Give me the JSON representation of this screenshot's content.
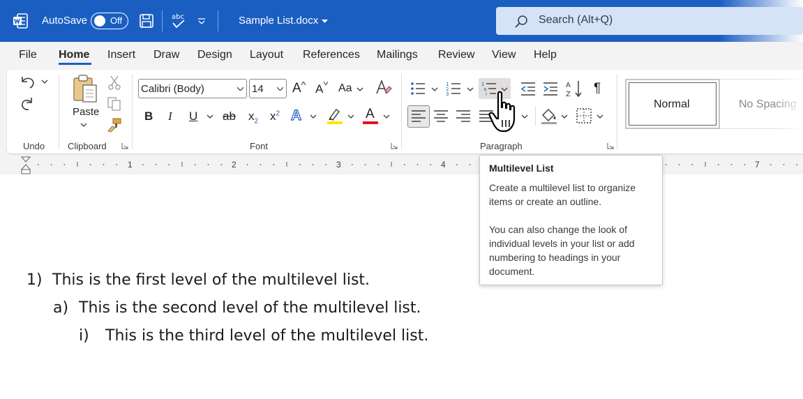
{
  "colors": {
    "accent": "#1a5ec2",
    "titlebar": "#1a5ec2",
    "search_bg": "#d4e3f6",
    "highlight_yellow": "#ffe600",
    "font_red": "#e81123"
  },
  "titlebar": {
    "autosave_label": "AutoSave",
    "autosave_state": "Off",
    "document_name": "Sample List.docx",
    "search_placeholder": "Search (Alt+Q)"
  },
  "tabs": [
    {
      "label": "File"
    },
    {
      "label": "Home",
      "active": true
    },
    {
      "label": "Insert"
    },
    {
      "label": "Draw"
    },
    {
      "label": "Design"
    },
    {
      "label": "Layout"
    },
    {
      "label": "References"
    },
    {
      "label": "Mailings"
    },
    {
      "label": "Review"
    },
    {
      "label": "View"
    },
    {
      "label": "Help"
    }
  ],
  "ribbon": {
    "undo_group": "Undo",
    "clipboard_group": "Clipboard",
    "paste_label": "Paste",
    "font_group": "Font",
    "font_name": "Calibri (Body)",
    "font_size": "14",
    "grow_font": "A",
    "shrink_font": "A",
    "change_case": "Aa",
    "bold": "B",
    "italic": "I",
    "underline": "U",
    "strikethrough": "ab",
    "subscript": "x",
    "superscript": "x",
    "subscript_mark": "2",
    "superscript_mark": "2",
    "text_effects": "A",
    "font_color": "A",
    "paragraph_group": "Paragraph",
    "styles": {
      "normal": "Normal",
      "no_spacing": "No Spacing"
    }
  },
  "ruler": {
    "numbers": [
      "1",
      "2",
      "3",
      "4",
      "7"
    ]
  },
  "tooltip": {
    "title": "Multilevel List",
    "paragraph1": "Create a multilevel list to organize items or create an outline.",
    "paragraph2": "You can also change the look of individual levels in your list or add numbering to headings in your document."
  },
  "document": {
    "lines": [
      {
        "marker": "1)",
        "text": "This is the first level of the multilevel list."
      },
      {
        "marker": "a)",
        "text": "This is the second level of the multilevel list."
      },
      {
        "marker": "i)",
        "text": "This is the third level of the multilevel list."
      }
    ]
  },
  "icons": [
    "word-logo-icon",
    "toggle-switch",
    "save-icon",
    "spelling-check-icon",
    "customize-qat-icon",
    "chevron-down-icon",
    "search-icon",
    "undo-icon",
    "redo-icon",
    "paste-icon",
    "cut-icon",
    "copy-icon",
    "format-painter-icon",
    "clear-formatting-icon",
    "bullets-icon",
    "numbering-icon",
    "multilevel-list-icon",
    "decrease-indent-icon",
    "increase-indent-icon",
    "sort-icon",
    "pilcrow-icon",
    "align-left-icon",
    "align-center-icon",
    "align-right-icon",
    "justify-icon",
    "shading-icon",
    "borders-icon",
    "hand-pointer-icon",
    "dialog-launcher-icon"
  ]
}
